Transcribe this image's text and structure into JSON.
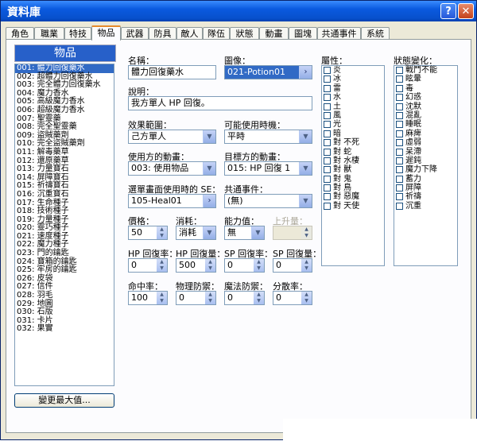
{
  "window": {
    "title": "資料庫"
  },
  "tabs": [
    "角色",
    "職業",
    "特技",
    "物品",
    "武器",
    "防具",
    "敵人",
    "隊伍",
    "狀態",
    "動畫",
    "圖塊",
    "共通事件",
    "系統"
  ],
  "list": {
    "header": "物品",
    "items": [
      "001: 體力回復藥水",
      "002: 超體力回復藥水",
      "003: 完全體力回復藥水",
      "004: 魔力香水",
      "005: 高級魔力香水",
      "006: 超級魔力香水",
      "007: 聖靈藥",
      "008: 完全聖靈藥",
      "009: 盜賊藥劑",
      "010: 完全盜賊藥劑",
      "011: 解毒藥草",
      "012: 還原藥草",
      "013: 力量寶石",
      "014: 屏障寶石",
      "015: 祈禱寶石",
      "016: 沉重寶石",
      "017: 生命種子",
      "018: 技術種子",
      "019: 力量種子",
      "020: 靈巧種子",
      "021: 速度種子",
      "022: 魔力種子",
      "023: 門的鑰匙",
      "024: 寶箱的鑰匙",
      "025: 牢房的鑰匙",
      "026: 皮袋",
      "027: 信件",
      "028: 羽毛",
      "029: 地圖",
      "030: 石版",
      "031: 卡片",
      "032: 果實"
    ],
    "max_button": "變更最大值..."
  },
  "form": {
    "name_label": "名稱：",
    "name": "體力回復藥水",
    "icon_label": "圖像：",
    "icon": "021-Potion01",
    "desc_label": "說明：",
    "desc": "我方單人 HP 回復。",
    "scope_label": "效果範圍：",
    "scope": "己方單人",
    "occasion_label": "可能使用時機：",
    "occasion": "平時",
    "user_anim_label": "使用方的動畫：",
    "user_anim": "003: 使用物品",
    "target_anim_label": "目標方的動畫：",
    "target_anim": "015: HP 回復 1",
    "menu_se_label": "選單畫面使用時的 SE：",
    "menu_se": "105-Heal01",
    "common_event_label": "共通事件：",
    "common_event": "(無)",
    "price_label": "價格：",
    "price": "50",
    "consumable_label": "消耗：",
    "consumable": "消耗",
    "param_label": "能力值：",
    "param": "無",
    "param_inc_label": "上升量：",
    "param_inc": "",
    "hp_rate_label": "HP 回復率：",
    "hp_rate": "0",
    "hp_amount_label": "HP 回復量：",
    "hp_amount": "500",
    "sp_rate_label": "SP 回復率：",
    "sp_rate": "0",
    "sp_amount_label": "SP 回復量：",
    "sp_amount": "0",
    "hit_label": "命中率：",
    "hit": "100",
    "pdef_label": "物理防禦：",
    "pdef": "0",
    "mdef_label": "魔法防禦：",
    "mdef": "0",
    "variance_label": "分散率：",
    "variance": "0"
  },
  "elements": {
    "label": "屬性：",
    "items": [
      "炎",
      "冰",
      "雷",
      "水",
      "土",
      "風",
      "光",
      "暗",
      "對 不死",
      "對 蛇",
      "對 水棲",
      "對 獸",
      "對 鬼",
      "對 鳥",
      "對 惡魔",
      "對 天使"
    ]
  },
  "states": {
    "label": "狀態變化：",
    "items": [
      "戰鬥不能",
      "眩暈",
      "毒",
      "幻惑",
      "沈默",
      "混亂",
      "睡眠",
      "麻痺",
      "虛弱",
      "呆滯",
      "遲鈍",
      "魔力下降",
      "蓄力",
      "屏障",
      "祈禱",
      "沉重"
    ]
  }
}
